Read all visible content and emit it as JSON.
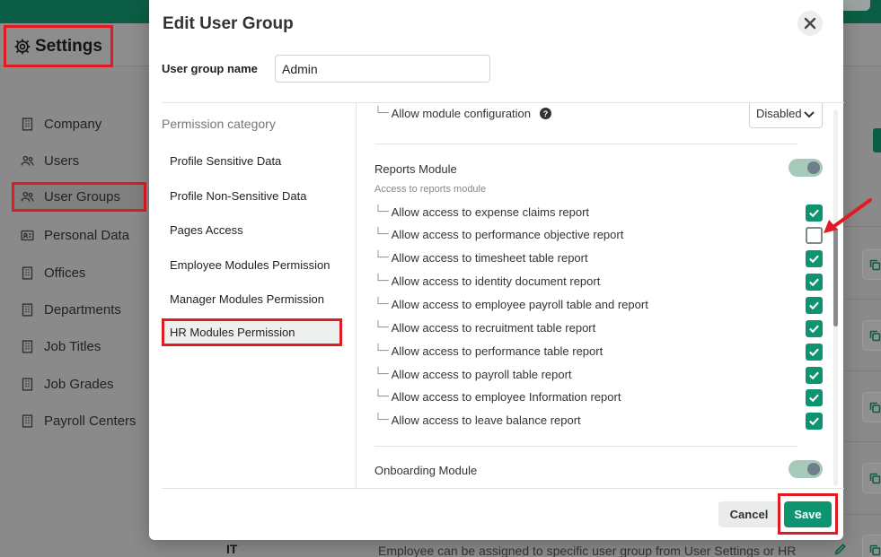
{
  "settings": {
    "title": "Settings"
  },
  "sidebar": {
    "items": [
      {
        "label": "Company",
        "icon": "building-icon"
      },
      {
        "label": "Users",
        "icon": "users-icon"
      },
      {
        "label": "User Groups",
        "icon": "users-icon",
        "active": true
      },
      {
        "label": "Personal Data",
        "icon": "id-card-icon"
      },
      {
        "label": "Offices",
        "icon": "building-icon"
      },
      {
        "label": "Departments",
        "icon": "building-icon"
      },
      {
        "label": "Job Titles",
        "icon": "building-icon"
      },
      {
        "label": "Job Grades",
        "icon": "building-icon"
      },
      {
        "label": "Payroll Centers",
        "icon": "building-icon"
      }
    ]
  },
  "background_table": {
    "last_row": {
      "name": "IT",
      "description": "Employee can be assigned to specific user group from User Settings or HR"
    }
  },
  "modal": {
    "title": "Edit User Group",
    "group_name_label": "User group name",
    "group_name_value": "Admin",
    "category_header": "Permission category",
    "categories": [
      {
        "label": "Profile Sensitive Data"
      },
      {
        "label": "Profile Non-Sensitive Data"
      },
      {
        "label": "Pages Access"
      },
      {
        "label": "Employee Modules Permission"
      },
      {
        "label": "Manager Modules Permission"
      },
      {
        "label": "HR Modules Permission",
        "active": true
      }
    ],
    "module_config": {
      "label": "Allow module configuration",
      "value": "Disabled"
    },
    "reports_module": {
      "title": "Reports Module",
      "subtitle": "Access to reports module",
      "enabled": true,
      "permissions": [
        {
          "label": "Allow access to expense claims report",
          "checked": true
        },
        {
          "label": "Allow access to performance objective report",
          "checked": false
        },
        {
          "label": "Allow access to timesheet table report",
          "checked": true
        },
        {
          "label": "Allow access to identity document report",
          "checked": true
        },
        {
          "label": "Allow access to employee payroll table and report",
          "checked": true
        },
        {
          "label": "Allow access to recruitment table report",
          "checked": true
        },
        {
          "label": "Allow access to performance table report",
          "checked": true
        },
        {
          "label": "Allow access to payroll table report",
          "checked": true
        },
        {
          "label": "Allow access to employee Information report",
          "checked": true
        },
        {
          "label": "Allow access to leave balance report",
          "checked": true
        }
      ]
    },
    "onboarding_module": {
      "title": "Onboarding Module",
      "enabled": true
    },
    "cancel_label": "Cancel",
    "save_label": "Save"
  },
  "colors": {
    "accent": "#0e9470",
    "highlight": "#e01b24",
    "topbar": "#0b5e45"
  }
}
